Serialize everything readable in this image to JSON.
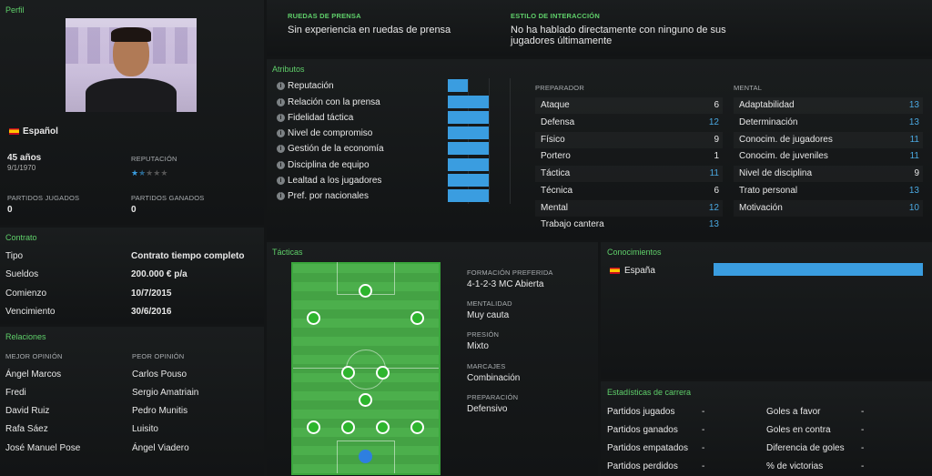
{
  "profile": {
    "header": "Perfil",
    "nationality": "Español",
    "age": "45 años",
    "dob": "9/1/1970",
    "reputation_label": "REPUTACIÓN",
    "reputation_stars": 1.5,
    "games_played_label": "PARTIDOS JUGADOS",
    "games_played": "0",
    "games_won_label": "PARTIDOS GANADOS",
    "games_won": "0"
  },
  "contract": {
    "header": "Contrato",
    "rows": [
      {
        "k": "Tipo",
        "v": "Contrato tiempo completo"
      },
      {
        "k": "Sueldos",
        "v": "200.000 € p/a"
      },
      {
        "k": "Comienzo",
        "v": "10/7/2015"
      },
      {
        "k": "Vencimiento",
        "v": "30/6/2016"
      }
    ]
  },
  "relations": {
    "header": "Relaciones",
    "best_label": "MEJOR OPINIÓN",
    "worst_label": "PEOR OPINIÓN",
    "best": [
      "Ángel Marcos",
      "Fredi",
      "David Ruiz",
      "Rafa Sáez",
      "José Manuel Pose"
    ],
    "worst": [
      "Carlos Pouso",
      "Sergio Amatriain",
      "Pedro Munitis",
      "Luisito",
      "Ángel Viadero"
    ]
  },
  "press": {
    "label": "RUEDAS DE PRENSA",
    "value": "Sin experiencia en ruedas de prensa"
  },
  "interaction": {
    "label": "ESTILO DE INTERACCIÓN",
    "value": "No ha hablado directamente con ninguno de sus jugadores últimamente"
  },
  "attributes": {
    "header": "Atributos",
    "items": [
      {
        "name": "Reputación",
        "level": 0.45
      },
      {
        "name": "Relación con la prensa",
        "level": 0.93
      },
      {
        "name": "Fidelidad táctica",
        "level": 0.93
      },
      {
        "name": "Nivel de compromiso",
        "level": 0.93
      },
      {
        "name": "Gestión de la economía",
        "level": 0.93
      },
      {
        "name": "Disciplina de equipo",
        "level": 0.93
      },
      {
        "name": "Lealtad a los jugadores",
        "level": 0.93
      },
      {
        "name": "Pref. por nacionales",
        "level": 0.93
      }
    ]
  },
  "coaching": {
    "header": "PREPARADOR",
    "items": [
      {
        "k": "Ataque",
        "v": "6"
      },
      {
        "k": "Defensa",
        "v": "12"
      },
      {
        "k": "Físico",
        "v": "9"
      },
      {
        "k": "Portero",
        "v": "1"
      },
      {
        "k": "Táctica",
        "v": "11"
      },
      {
        "k": "Técnica",
        "v": "6"
      },
      {
        "k": "Mental",
        "v": "12"
      },
      {
        "k": "Trabajo cantera",
        "v": "13"
      }
    ]
  },
  "mental": {
    "header": "MENTAL",
    "items": [
      {
        "k": "Adaptabilidad",
        "v": "13"
      },
      {
        "k": "Determinación",
        "v": "13"
      },
      {
        "k": "Conocim. de jugadores",
        "v": "11"
      },
      {
        "k": "Conocim. de juveniles",
        "v": "11"
      },
      {
        "k": "Nivel de disciplina",
        "v": "9"
      },
      {
        "k": "Trato personal",
        "v": "13"
      },
      {
        "k": "Motivación",
        "v": "10"
      }
    ]
  },
  "tactics": {
    "header": "Tácticas",
    "formation_label": "FORMACIÓN PREFERIDA",
    "formation": "4-1-2-3 MC Abierta",
    "mentality_label": "MENTALIDAD",
    "mentality": "Muy cauta",
    "pressing_label": "PRESIÓN",
    "pressing": "Mixto",
    "marking_label": "MARCAJES",
    "marking": "Combinación",
    "training_label": "PREPARACIÓN",
    "training": "Defensivo"
  },
  "knowledge": {
    "header": "Conocimientos",
    "country": "España",
    "level": 1.0
  },
  "career": {
    "header": "Estadísticas de carrera",
    "left": [
      {
        "k": "Partidos jugados",
        "v": "-"
      },
      {
        "k": "Partidos ganados",
        "v": "-"
      },
      {
        "k": "Partidos empatados",
        "v": "-"
      },
      {
        "k": "Partidos perdidos",
        "v": "-"
      }
    ],
    "right": [
      {
        "k": "Goles a favor",
        "v": "-"
      },
      {
        "k": "Goles en contra",
        "v": "-"
      },
      {
        "k": "Diferencia de goles",
        "v": "-"
      },
      {
        "k": "% de victorias",
        "v": "-"
      }
    ]
  },
  "colors": {
    "accent": "#5fcf6a",
    "bar": "#3a9de0",
    "value": "#4aa8e0"
  }
}
